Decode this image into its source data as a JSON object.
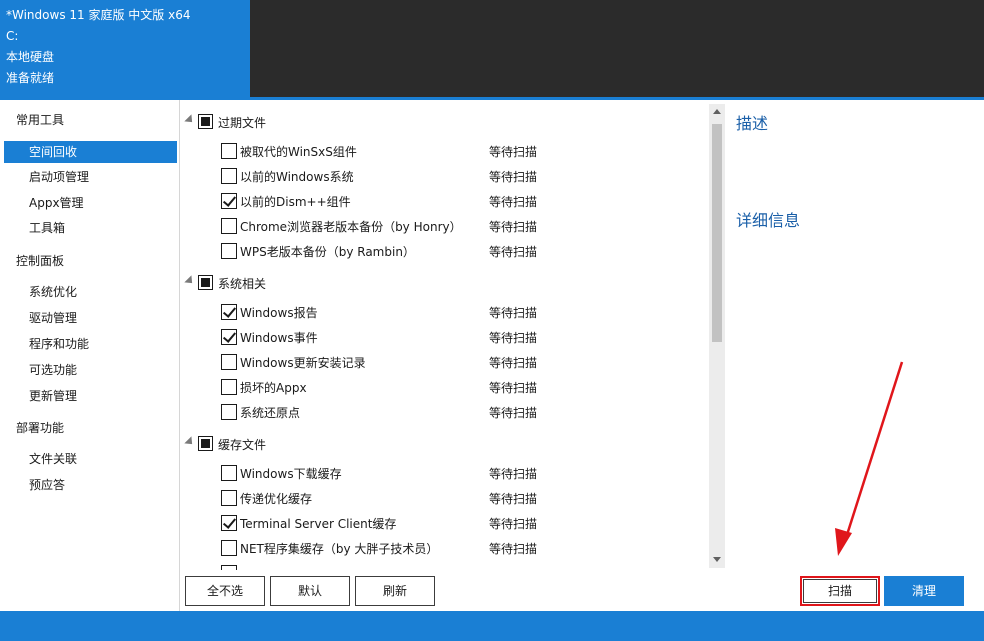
{
  "header": {
    "system_name": "*Windows 11 家庭版 中文版 x64",
    "drive": "C:",
    "disk_label": "本地硬盘",
    "status": "准备就绪"
  },
  "sidebar": {
    "groups": [
      {
        "title": "常用工具",
        "items": [
          "空间回收",
          "启动项管理",
          "Appx管理",
          "工具箱"
        ]
      },
      {
        "title": "控制面板",
        "items": [
          "系统优化",
          "驱动管理",
          "程序和功能",
          "可选功能",
          "更新管理"
        ]
      },
      {
        "title": "部署功能",
        "items": [
          "文件关联",
          "预应答"
        ]
      }
    ],
    "selected": "空间回收"
  },
  "tree": {
    "categories": [
      {
        "label": "过期文件",
        "items": [
          {
            "name": "被取代的WinSxS组件",
            "checked": false,
            "status": "等待扫描"
          },
          {
            "name": "以前的Windows系统",
            "checked": false,
            "status": "等待扫描"
          },
          {
            "name": "以前的Dism++组件",
            "checked": true,
            "status": "等待扫描"
          },
          {
            "name": "Chrome浏览器老版本备份（by Honry）",
            "checked": false,
            "status": "等待扫描"
          },
          {
            "name": "WPS老版本备份（by Rambin）",
            "checked": false,
            "status": "等待扫描"
          }
        ]
      },
      {
        "label": "系统相关",
        "items": [
          {
            "name": "Windows报告",
            "checked": true,
            "status": "等待扫描"
          },
          {
            "name": "Windows事件",
            "checked": true,
            "status": "等待扫描"
          },
          {
            "name": "Windows更新安装记录",
            "checked": false,
            "status": "等待扫描"
          },
          {
            "name": "损坏的Appx",
            "checked": false,
            "status": "等待扫描"
          },
          {
            "name": "系统还原点",
            "checked": false,
            "status": "等待扫描"
          }
        ]
      },
      {
        "label": "缓存文件",
        "items": [
          {
            "name": "Windows下载缓存",
            "checked": false,
            "status": "等待扫描"
          },
          {
            "name": "传递优化缓存",
            "checked": false,
            "status": "等待扫描"
          },
          {
            "name": "Terminal Server Client缓存",
            "checked": true,
            "status": "等待扫描"
          },
          {
            "name": "NET程序集缓存（by 大胖子技术员）",
            "checked": false,
            "status": "等待扫描"
          }
        ]
      }
    ]
  },
  "right_panel": {
    "description_title": "描述",
    "detail_title": "详细信息"
  },
  "buttons": {
    "select_none": "全不选",
    "default": "默认",
    "refresh": "刷新",
    "scan": "扫描",
    "clean": "清理"
  },
  "colors": {
    "accent": "#1a7fd4",
    "header_dark": "#2b2b2b",
    "annotation_red": "#e0161b"
  }
}
